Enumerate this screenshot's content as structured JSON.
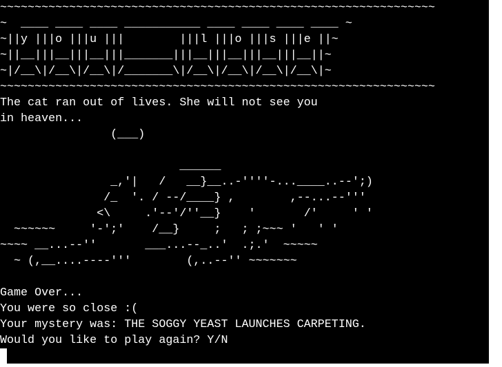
{
  "banner": {
    "lines": [
      "~~~~~~~~~~~~~~~~~~~~~~~~~~~~~~~~~~~~~~~~~~~~~~~~~~~~~~~~~~~~~~~",
      "~  ____ ____ ____ ___________ ____ ____ ____ ____ ~",
      "~||y |||o |||u |||        |||l |||o |||s |||e ||~",
      "~||__|||__|||__|||_______|||__|||__|||__|||__||~",
      "~|/__\\|/__\\|/__\\|/_______\\|/__\\|/__\\|/__\\|/__\\|~",
      "~~~~~~~~~~~~~~~~~~~~~~~~~~~~~~~~~~~~~~~~~~~~~~~~~~~~~~~~~~~~~~~"
    ]
  },
  "message": {
    "line1": "The cat ran out of lives. She will not see you",
    "line2": "in heaven..."
  },
  "art": {
    "lines": [
      "                (___)",
      "",
      "                          ______",
      "                _,'|   /   __}__..-''''-...____..--';)",
      "               /_  '. / --/____} ,        ,--...--'''",
      "              <\\     .'--'/''__}    '       /'     ' '",
      "  ~~~~~~     '-';'    /__}     ;   ; ;~~~ '   ' '",
      "~~~~ __...--''       ___...--_..'  .;.'  ~~~~~",
      "  ~ (,__....----'''        (,..--'' ~~~~~~~"
    ]
  },
  "game_over": {
    "title": "Game Over...",
    "close": "You were so close :(",
    "mystery": "Your mystery was: THE SOGGY YEAST LAUNCHES CARPETING.",
    "prompt": "Would you like to play again? Y/N"
  },
  "input": {
    "prompt": ">>",
    "value": ""
  }
}
